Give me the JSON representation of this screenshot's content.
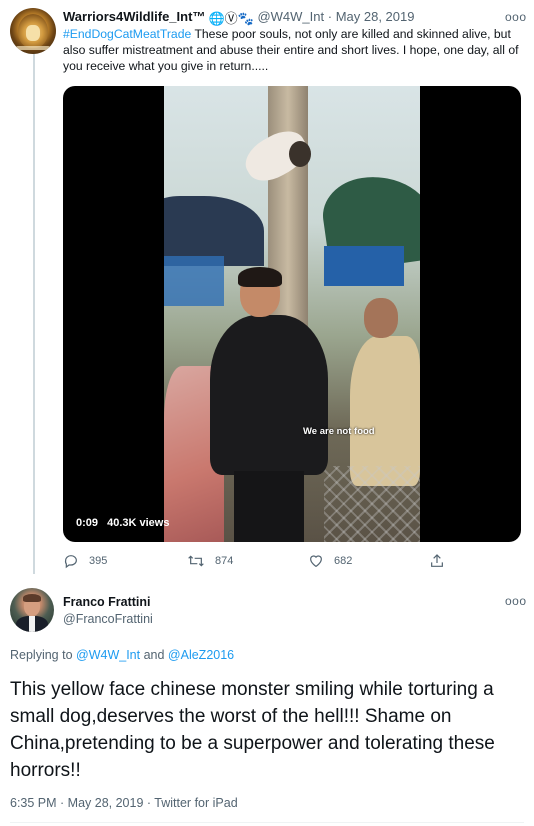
{
  "tweet1": {
    "author_name": "Warriors4Wildlife_Int™",
    "author_emoji": "🌐Ⓥ🐾",
    "handle": "@W4W_Int",
    "separator": "·",
    "date": "May 28, 2019",
    "more": "ooo",
    "hashtag": "#EndDogCatMeatTrade",
    "text": " These poor souls, not only are killed and skinned alive, but also suffer mistreatment and abuse their entire and short lives. I hope, one day, all of you receive what you give in return.....",
    "video": {
      "subtitle": "We are not food",
      "duration": "0:09",
      "views": "40.3K views"
    },
    "actions": {
      "replies": "395",
      "retweets": "874",
      "likes": "682"
    }
  },
  "tweet2": {
    "author_name": "Franco Frattini",
    "handle": "@FrancoFrattini",
    "more": "ooo",
    "replying_prefix": "Replying to ",
    "replying_user1": "@W4W_Int",
    "replying_and": " and ",
    "replying_user2": "@AleZ2016",
    "text": "This yellow face chinese monster smiling while torturing a small dog,deserves the worst of the hell!!!  Shame on China,pretending to be a superpower and tolerating these horrors!!",
    "meta": "6:35 PM · May 28, 2019 · Twitter for iPad"
  },
  "colors": {
    "link": "#1d9bf0",
    "muted": "#536471",
    "text": "#0f1419"
  }
}
